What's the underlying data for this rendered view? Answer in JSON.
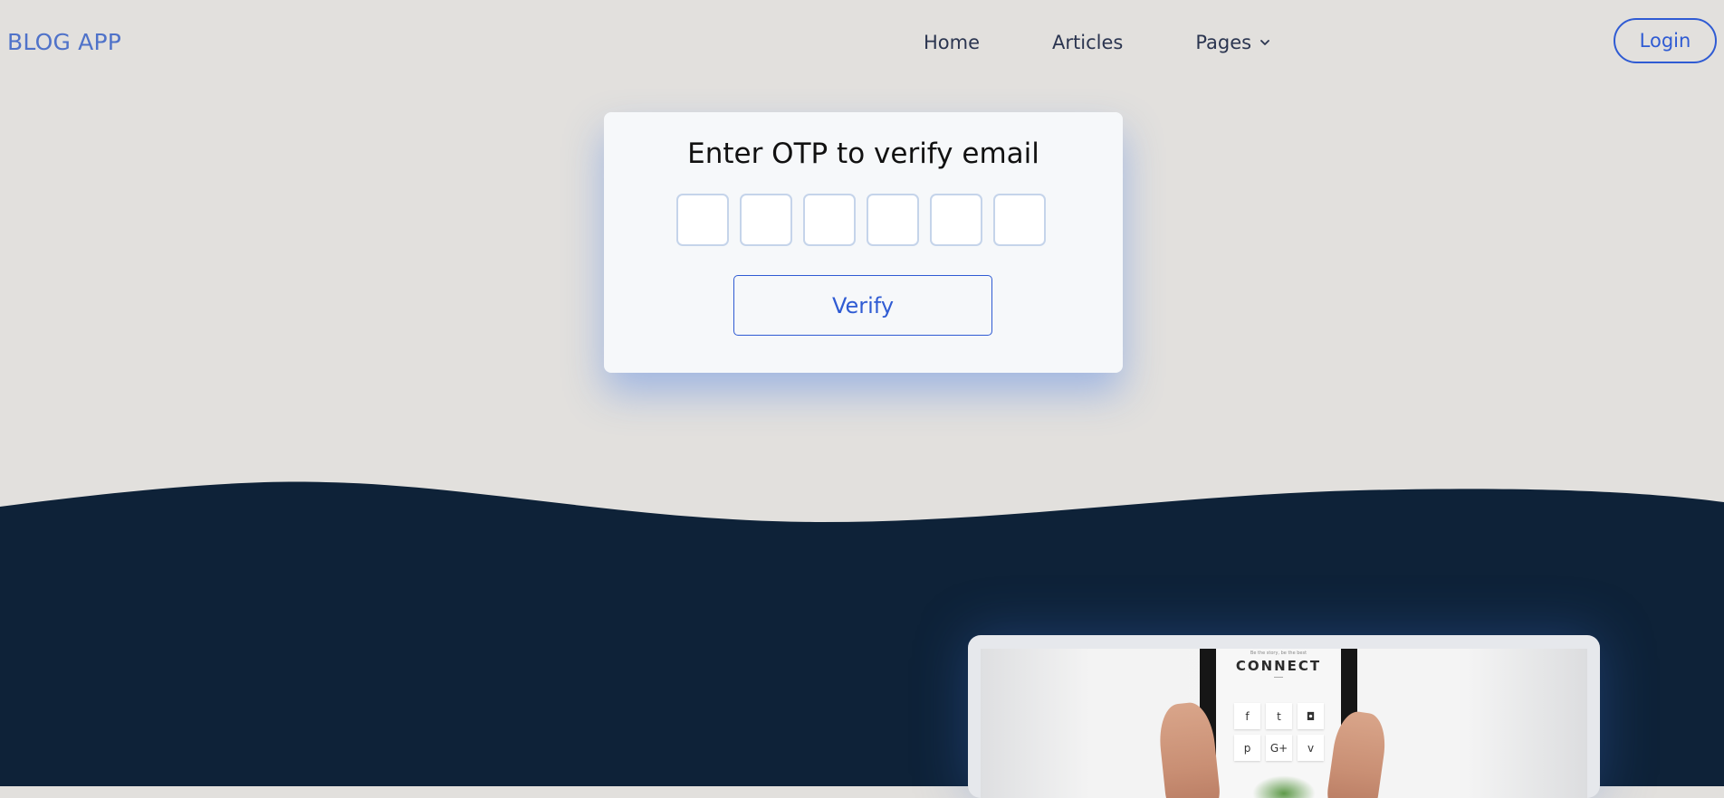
{
  "header": {
    "brand": "BLOG APP",
    "nav": [
      {
        "label": "Home"
      },
      {
        "label": "Articles"
      },
      {
        "label": "Pages",
        "icon": "chevron-down-icon"
      }
    ],
    "login_label": "Login"
  },
  "otp": {
    "title": "Enter OTP to verify email",
    "digits": [
      "",
      "",
      "",
      "",
      "",
      ""
    ],
    "verify_label": "Verify"
  },
  "preview": {
    "screen_caption": "Be the story, be the best",
    "heading": "CONNECT",
    "social_icons": [
      "facebook-icon",
      "twitter-icon",
      "instagram-icon",
      "pinterest-icon",
      "google-plus-icon",
      "vine-icon"
    ],
    "social_glyphs": [
      "f",
      "t",
      "◘",
      "p",
      "G+",
      "v"
    ]
  },
  "colors": {
    "page_bg": "#e2e0dd",
    "accent": "#2f5bd3",
    "brand": "#4f72c9",
    "dark_section": "#0e2238",
    "card_bg": "#f6f8fa"
  }
}
